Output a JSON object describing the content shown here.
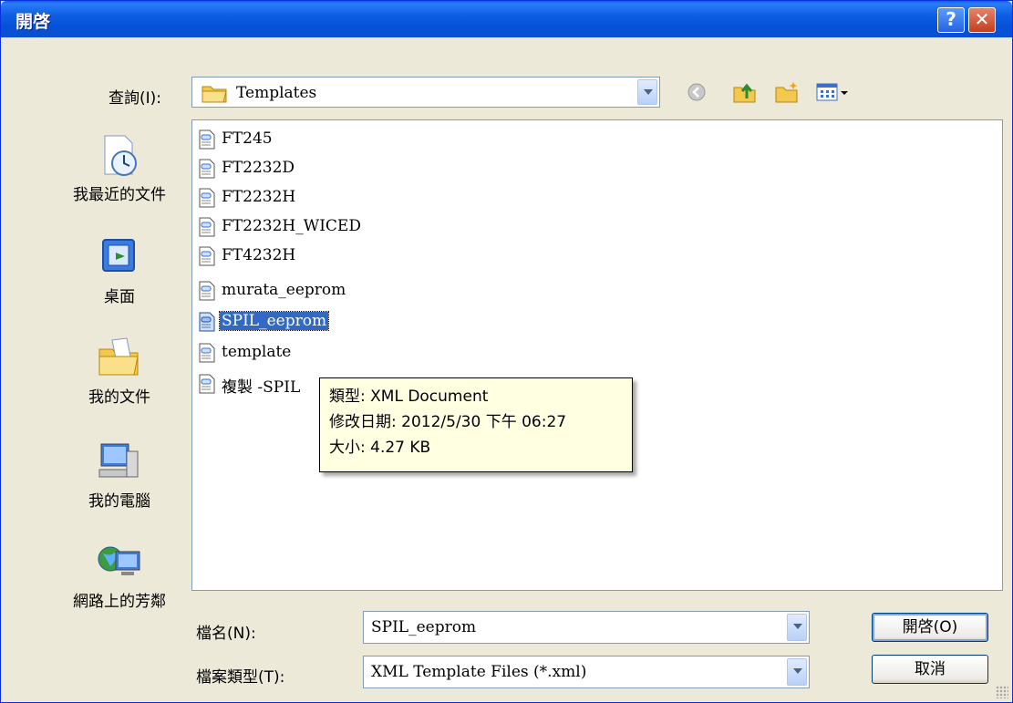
{
  "window": {
    "title": "開啓",
    "help_label": "?",
    "close_label": "✕"
  },
  "lookin": {
    "label": "查詢(I):",
    "value": "Templates"
  },
  "toolbar": {
    "icons": [
      "back-icon",
      "up-folder-icon",
      "new-folder-icon",
      "view-menu-icon"
    ]
  },
  "places": [
    {
      "label": "我最近的文件",
      "icon": "recent-documents-icon"
    },
    {
      "label": "桌面",
      "icon": "desktop-icon"
    },
    {
      "label": "我的文件",
      "icon": "my-documents-icon"
    },
    {
      "label": "我的電腦",
      "icon": "my-computer-icon"
    },
    {
      "label": "網路上的芳鄰",
      "icon": "network-places-icon"
    }
  ],
  "files": [
    {
      "name": "FT245"
    },
    {
      "name": "FT2232D"
    },
    {
      "name": "FT2232H"
    },
    {
      "name": "FT2232H_WICED"
    },
    {
      "name": "FT4232H"
    },
    {
      "name": "murata_eeprom"
    },
    {
      "name": "SPIL_eeprom",
      "selected": true
    },
    {
      "name": "template"
    },
    {
      "name": "複製 -SPIL"
    }
  ],
  "tooltip": {
    "type_line": "類型: XML Document",
    "modified_line": "修改日期: 2012/5/30 下午 06:27",
    "size_line": "大小: 4.27 KB"
  },
  "filename": {
    "label": "檔名(N):",
    "value": "SPIL_eeprom"
  },
  "filetype": {
    "label": "檔案類型(T):",
    "value": "XML Template Files (*.xml)"
  },
  "buttons": {
    "open_label": "開啓(O)",
    "cancel_label": "取消"
  },
  "colors": {
    "title_blue": "#0a5fe8",
    "selection_blue": "#316ac5",
    "tooltip_bg": "#ffffe1"
  }
}
